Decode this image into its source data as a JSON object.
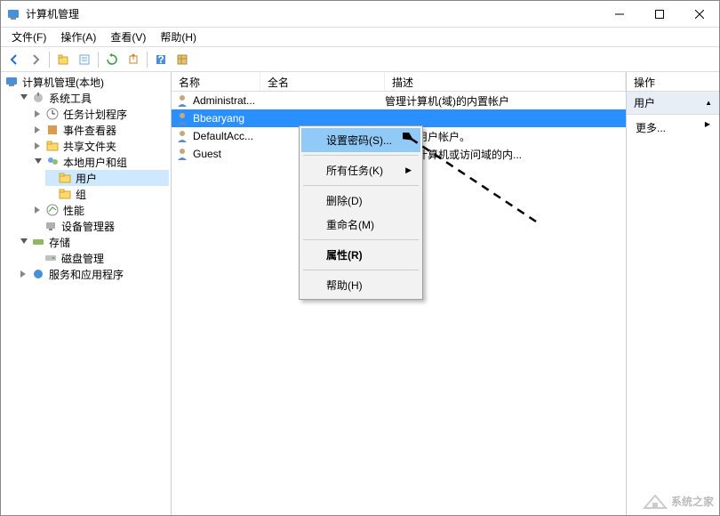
{
  "titlebar": {
    "title": "计算机管理"
  },
  "menubar": {
    "file": "文件(F)",
    "action": "操作(A)",
    "view": "查看(V)",
    "help": "帮助(H)"
  },
  "tree": {
    "root": "计算机管理(本地)",
    "systools": "系统工具",
    "taskscheduler": "任务计划程序",
    "eventviewer": "事件查看器",
    "sharedfolders": "共享文件夹",
    "localusers": "本地用户和组",
    "users": "用户",
    "groups": "组",
    "perf": "性能",
    "devmgr": "设备管理器",
    "storage": "存储",
    "diskmgmt": "磁盘管理",
    "services": "服务和应用程序"
  },
  "list": {
    "headers": {
      "name": "名称",
      "fullname": "全名",
      "desc": "描述"
    },
    "rows": [
      {
        "name": "Administrat...",
        "full": "",
        "desc": "管理计算机(域)的内置帐户"
      },
      {
        "name": "Bbearyang",
        "full": "",
        "desc": ""
      },
      {
        "name": "DefaultAcc...",
        "full": "",
        "desc": "管理的用户帐户。"
      },
      {
        "name": "Guest",
        "full": "",
        "desc": "宾访问计算机或访问域的内..."
      }
    ]
  },
  "actions": {
    "header": "操作",
    "section": "用户",
    "more": "更多..."
  },
  "context": {
    "setpwd": "设置密码(S)...",
    "alltasks": "所有任务(K)",
    "del": "删除(D)",
    "rename": "重命名(M)",
    "props": "属性(R)",
    "help": "帮助(H)"
  },
  "watermark": "系统之家"
}
